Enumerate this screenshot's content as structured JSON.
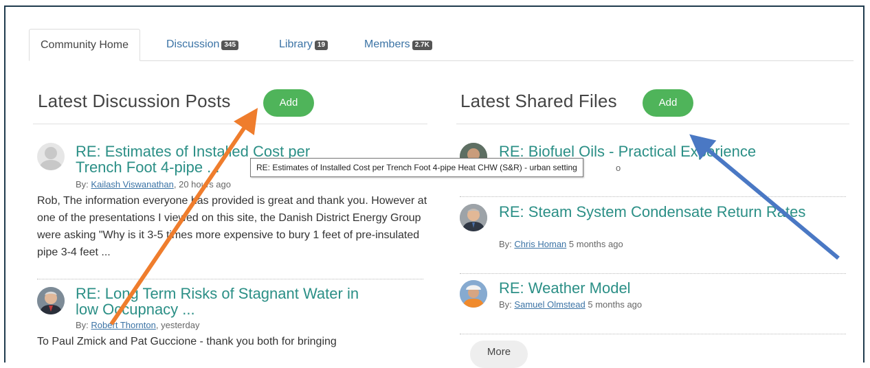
{
  "tabs": [
    {
      "label": "Community Home",
      "badge": ""
    },
    {
      "label": "Discussion",
      "badge": "345"
    },
    {
      "label": "Library",
      "badge": "19"
    },
    {
      "label": "Members",
      "badge": "2.7K"
    }
  ],
  "discussion": {
    "title": "Latest Discussion Posts",
    "add_label": "Add",
    "posts": [
      {
        "title": "RE: Estimates of Installed Cost per Trench Foot 4-pipe ...",
        "by": "By:",
        "author": "Kailash Viswanathan",
        "time": ", 20 hours ago",
        "excerpt": "Rob, The information everyone has provided is great and thank you. However at one of the presentations I viewed on this site, the Danish District Energy Group were asking \"Why is it 3-5 times more expensive to bury 1 feet of pre-insulated pipe 3-4 feet ..."
      },
      {
        "title": "RE: Long Term Risks of Stagnant Water in low Occupnacy ...",
        "by": "By:",
        "author": "Robert Thornton",
        "time": ", yesterday",
        "excerpt": "To Paul Zmick and Pat Guccione - thank you both for bringing"
      }
    ]
  },
  "files": {
    "title": "Latest Shared Files",
    "add_label": "Add",
    "items": [
      {
        "title": "RE: Biofuel Oils - Practical Experience",
        "by": "By:",
        "author": "",
        "time": "o"
      },
      {
        "title": "RE: Steam System Condensate Return Rates",
        "by": "By:",
        "author": "Chris Homan",
        "time": " 5 months ago"
      },
      {
        "title": "RE: Weather Model",
        "by": "By:",
        "author": "Samuel Olmstead",
        "time": " 5 months ago"
      }
    ],
    "more_label": "More"
  },
  "tooltip": "RE: Estimates of Installed Cost per Trench Foot 4-pipe Heat CHW (S&R) - urban setting",
  "colors": {
    "accent_green": "#4fb45a",
    "link_teal": "#2b8f86",
    "link_blue": "#3b73a5",
    "arrow_orange": "#ef7d2d",
    "arrow_blue": "#4a78c4"
  }
}
